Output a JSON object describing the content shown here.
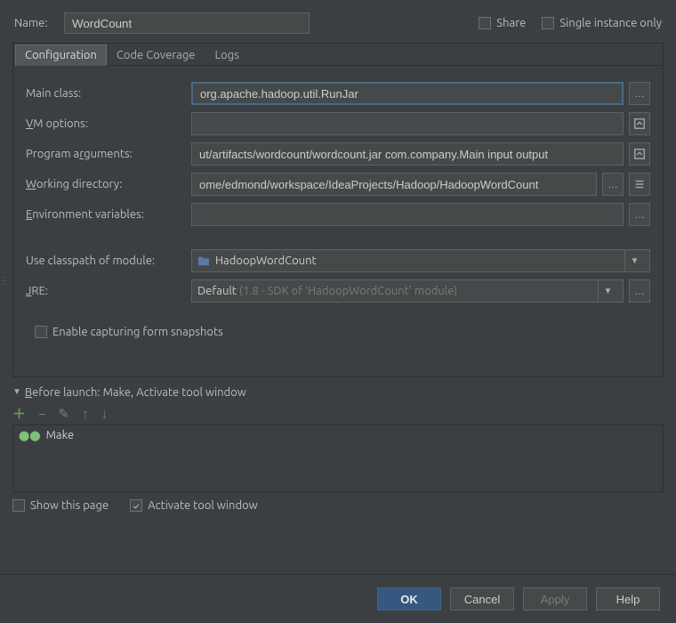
{
  "top": {
    "name_label": "Name:",
    "name_value": "WordCount",
    "share_label": "Share",
    "single_instance_label": "Single instance only"
  },
  "tabs": {
    "configuration": "Configuration",
    "code_coverage": "Code Coverage",
    "logs": "Logs"
  },
  "form": {
    "main_class_label_prefix": "Main class:",
    "main_class_value": "org.apache.hadoop.util.RunJar",
    "vm_label_ul": "V",
    "vm_label_rest": "M options:",
    "vm_value": "",
    "pa_pre": "Program a",
    "pa_ul": "r",
    "pa_post": "guments:",
    "pa_value": "ut/artifacts/wordcount/wordcount.jar com.company.Main input output",
    "wd_ul": "W",
    "wd_rest": "orking directory:",
    "wd_value": "ome/edmond/workspace/IdeaProjects/Hadoop/HadoopWordCount",
    "env_ul": "E",
    "env_rest": "nvironment variables:",
    "env_value": "",
    "classpath_label": "Use classpath of module:",
    "classpath_value": "HadoopWordCount",
    "jre_ul": "J",
    "jre_rest": "RE:",
    "jre_pre": "Default",
    "jre_dim": "(1.8 - SDK of 'HadoopWordCount' module)",
    "enable_snap_ul": "E",
    "enable_snap_rest": "nable capturing form snapshots"
  },
  "before": {
    "header_ul": "B",
    "header_rest": "efore launch: Make, Activate tool window",
    "item_label": "Make",
    "show_label": "Show this page",
    "activate_label": "Activate tool window"
  },
  "footer": {
    "ok": "OK",
    "cancel": "Cancel",
    "apply": "Apply",
    "help": "Help"
  }
}
